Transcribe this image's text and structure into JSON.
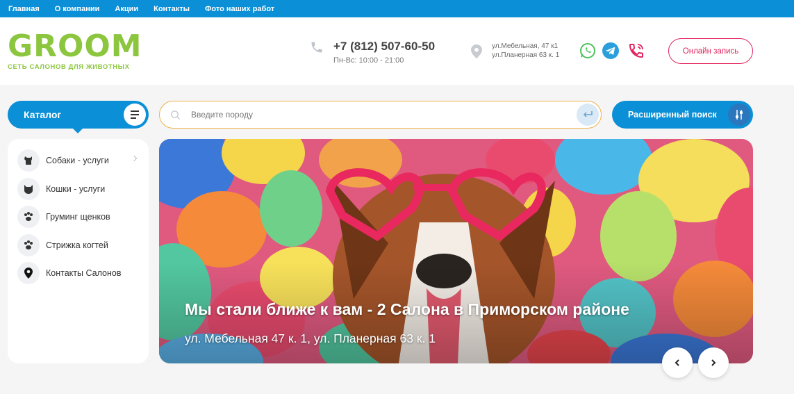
{
  "topnav": {
    "items": [
      "Главная",
      "О компании",
      "Акции",
      "Контакты",
      "Фото наших работ"
    ]
  },
  "logo": {
    "word": "GROOM",
    "subtitle": "СЕТЬ САЛОНОВ ДЛЯ ЖИВОТНЫХ",
    "color": "#8cc63f"
  },
  "contact": {
    "phone": "+7 (812) 507-60-50",
    "hours": "Пн-Вс: 10:00 - 21:00",
    "address_line1": "ул.Мебельная, 47 к1",
    "address_line2": "ул.Планерная 63 к. 1"
  },
  "social": {
    "icons": [
      "whatsapp-icon",
      "telegram-icon",
      "phone-call-icon"
    ]
  },
  "header": {
    "online_button": "Онлайн запись"
  },
  "catalog": {
    "label": "Каталог",
    "items": [
      {
        "label": "Собаки - услуги",
        "icon": "dog-icon"
      },
      {
        "label": "Кошки - услуги",
        "icon": "cat-icon"
      },
      {
        "label": "Груминг щенков",
        "icon": "paw-icon"
      },
      {
        "label": "Стрижка когтей",
        "icon": "paw-icon"
      },
      {
        "label": "Контакты Салонов",
        "icon": "map-pin-icon"
      }
    ]
  },
  "search": {
    "placeholder": "Введите породу",
    "value": ""
  },
  "advanced_search": {
    "label": "Расширенный поиск"
  },
  "banner": {
    "title": "Мы стали ближе к вам - 2 Салона в Приморском районе",
    "subtitle": "ул. Мебельная 47 к. 1, ул. Планерная 63 к. 1"
  },
  "colors": {
    "primary_blue": "#0b8fd6",
    "accent_pink": "#e0245e",
    "search_border": "#f0b04a"
  }
}
